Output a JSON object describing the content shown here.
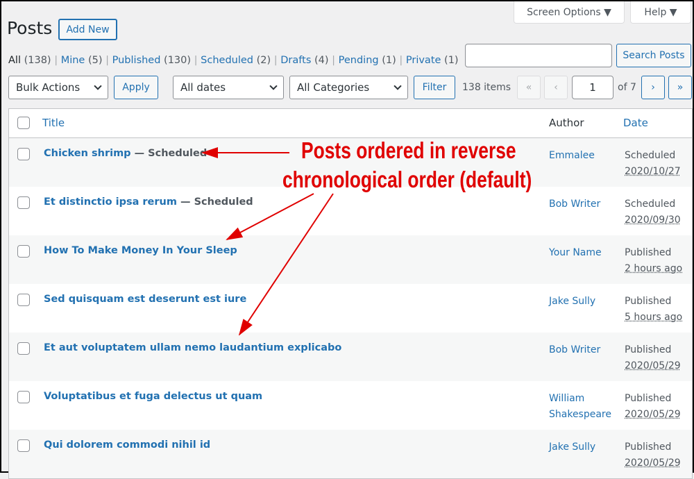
{
  "header": {
    "title": "Posts",
    "add_new": "Add New",
    "screen_options": "Screen Options ▼",
    "help": "Help ▼"
  },
  "filters": [
    {
      "label": "All",
      "count": "(138)",
      "current": true
    },
    {
      "label": "Mine",
      "count": "(5)"
    },
    {
      "label": "Published",
      "count": "(130)"
    },
    {
      "label": "Scheduled",
      "count": "(2)"
    },
    {
      "label": "Drafts",
      "count": "(4)"
    },
    {
      "label": "Pending",
      "count": "(1)"
    },
    {
      "label": "Private",
      "count": "(1)"
    }
  ],
  "search": {
    "value": "",
    "button": "Search Posts"
  },
  "toolbar": {
    "bulk_actions": "Bulk Actions",
    "apply": "Apply",
    "dates": "All dates",
    "categories": "All Categories",
    "filter": "Filter",
    "items": "138 items",
    "first": "«",
    "prev": "‹",
    "page": "1",
    "of": "of 7",
    "next": "›",
    "last": "»"
  },
  "columns": {
    "title": "Title",
    "author": "Author",
    "date": "Date"
  },
  "rows": [
    {
      "title": "Chicken shrimp",
      "state": " — Scheduled",
      "author": "Emmalee",
      "status": "Scheduled",
      "date": "2020/10/27"
    },
    {
      "title": "Et distinctio ipsa rerum",
      "state": " — Scheduled",
      "author": "Bob Writer",
      "status": "Scheduled",
      "date": "2020/09/30"
    },
    {
      "title": "How To Make Money In Your Sleep",
      "state": "",
      "author": "Your Name",
      "status": "Published",
      "date": "2 hours ago"
    },
    {
      "title": "Sed quisquam est deserunt est iure",
      "state": "",
      "author": "Jake Sully",
      "status": "Published",
      "date": "5 hours ago"
    },
    {
      "title": "Et aut voluptatem ullam nemo laudantium explicabo",
      "state": "",
      "author": "Bob Writer",
      "status": "Published",
      "date": "2020/05/29"
    },
    {
      "title": "Voluptatibus et fuga delectus ut quam",
      "state": "",
      "author": "William Shakespeare",
      "status": "Published",
      "date": "2020/05/29"
    },
    {
      "title": "Qui dolorem commodi nihil id",
      "state": "",
      "author": "Jake Sully",
      "status": "Published",
      "date": "2020/05/29"
    }
  ],
  "annotation": {
    "line1": "Posts ordered in reverse",
    "line2": "chronological order (default)",
    "color": "#e00000"
  }
}
